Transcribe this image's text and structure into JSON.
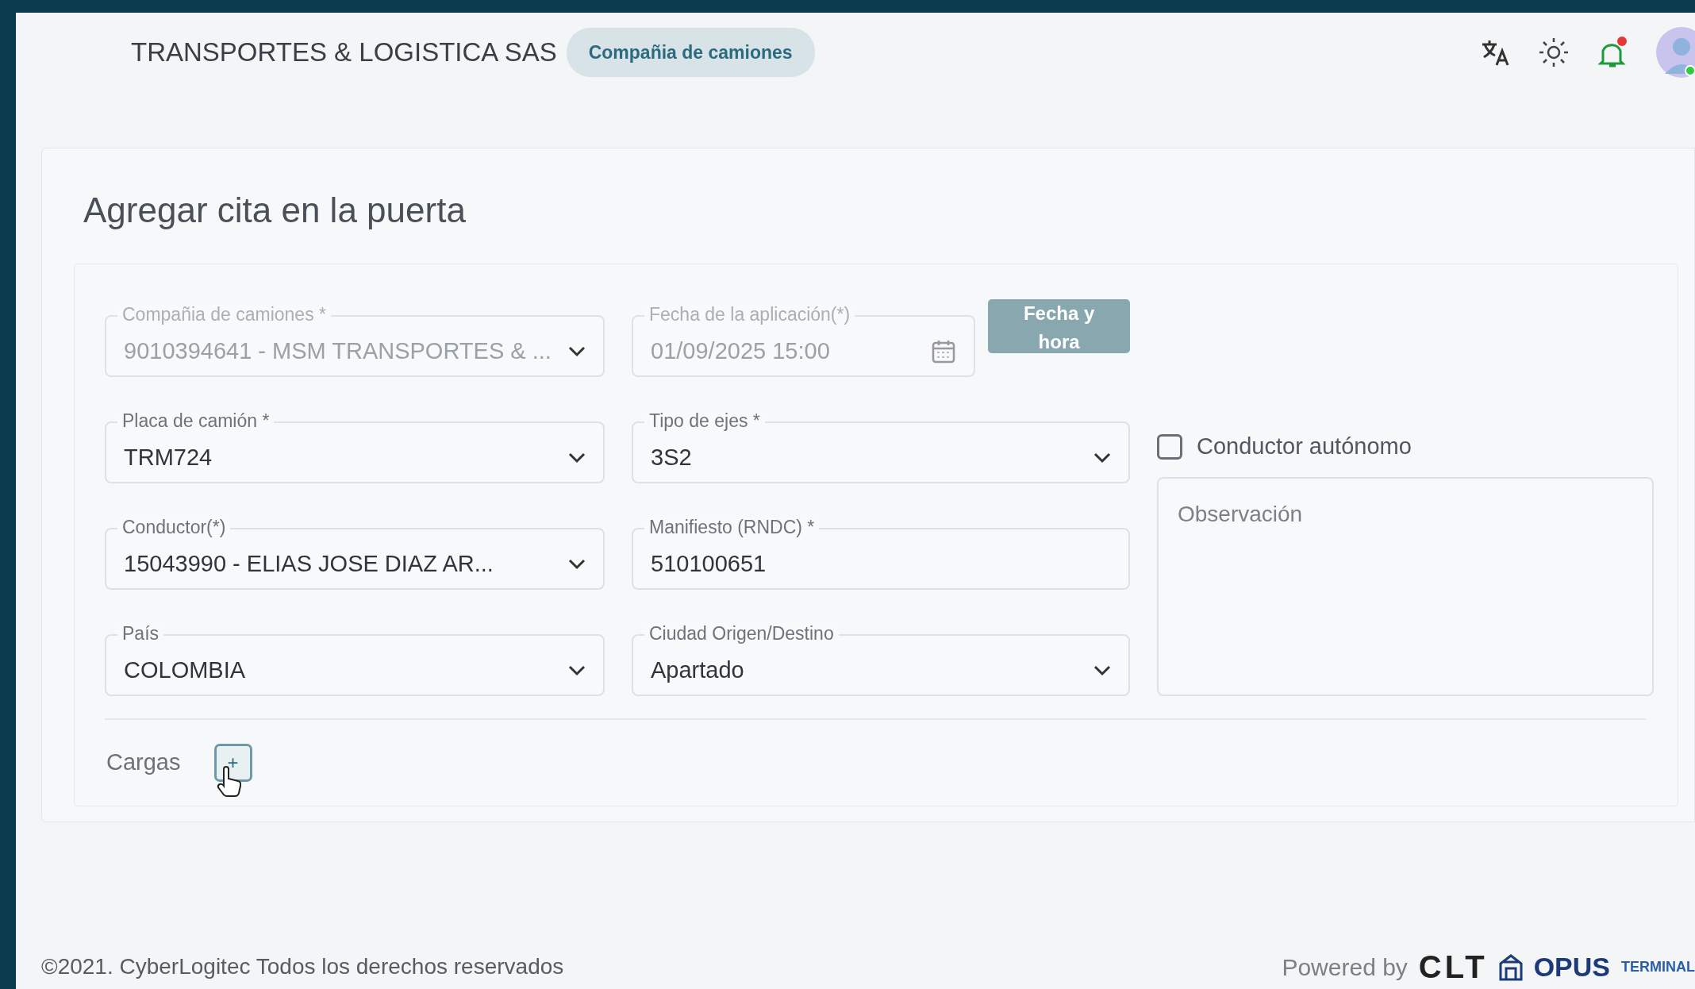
{
  "header": {
    "company": "TRANSPORTES & LOGISTICA SAS",
    "badge": "Compañia de camiones",
    "notifications_unread": true,
    "user_online": true
  },
  "page": {
    "title": "Agregar cita en la puerta"
  },
  "fields": [
    {
      "kind": "select",
      "label": "Compañia de camiones *",
      "value": "9010394641 - MSM TRANSPORTES & ...",
      "disabled": true
    },
    {
      "kind": "date",
      "label": "Fecha de la aplicación(*)",
      "value": "01/09/2025 15:00",
      "disabled": true,
      "button": "Fecha y hora"
    },
    {
      "kind": "select",
      "label": "Placa de camión *",
      "value": "TRM724",
      "disabled": false
    },
    {
      "kind": "select",
      "label": "Tipo de ejes *",
      "value": "3S2",
      "disabled": false
    },
    {
      "kind": "select",
      "label": "Conductor(*)",
      "value": "15043990 - ELIAS JOSE DIAZ AR...",
      "disabled": false
    },
    {
      "kind": "text",
      "label": "Manifiesto (RNDC) *",
      "value": "510100651",
      "disabled": false
    },
    {
      "kind": "select",
      "label": "País",
      "value": "COLOMBIA",
      "disabled": false
    },
    {
      "kind": "select",
      "label": "Ciudad Origen/Destino",
      "value": "Apartado",
      "disabled": false
    }
  ],
  "checkbox": {
    "label": "Conductor autónomo",
    "checked": false
  },
  "observation": {
    "placeholder": "Observación"
  },
  "cargas": {
    "label": "Cargas",
    "add_button": "+"
  },
  "footer": {
    "copyright": "©2021. CyberLogitec Todos los derechos reservados",
    "powered_by": "Powered by",
    "logos": [
      "CLT",
      "OPUS",
      "TERMINAL"
    ]
  }
}
